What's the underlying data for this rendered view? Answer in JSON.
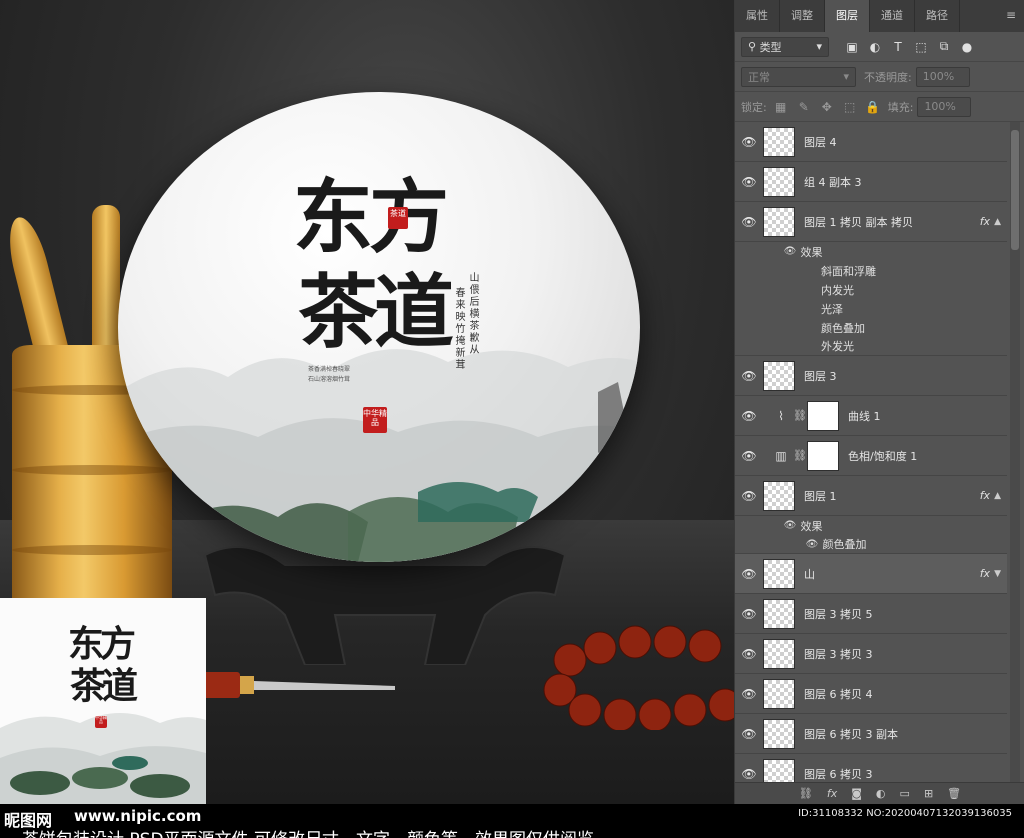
{
  "artwork": {
    "title_line1": "东方",
    "title_line2": "茶道",
    "seal_top": "茶道",
    "seal_bottom": "中华精品",
    "poem_columns": [
      "山偎后横茶歉从",
      "春来映竹掩新茸"
    ],
    "caption_lines": [
      "茶香满棹春晓翠",
      "石山溶溶烟竹茸"
    ]
  },
  "panel": {
    "tabs": [
      "属性",
      "调整",
      "图层",
      "通道",
      "路径"
    ],
    "active_tab": "图层",
    "filter_label": "类型",
    "blend_mode": "正常",
    "opacity_label": "不透明度:",
    "opacity_value": "100%",
    "lock_label": "锁定:",
    "fill_label": "填充:",
    "fill_value": "100%",
    "layers": [
      {
        "name": "图层 4",
        "kind": "image"
      },
      {
        "name": "组 4 副本 3",
        "kind": "image"
      },
      {
        "name": "图层 1 拷贝 副本 拷贝",
        "kind": "image",
        "fx": "fx"
      },
      {
        "name": "图层 3",
        "kind": "image"
      },
      {
        "name": "曲线 1",
        "kind": "adjustment"
      },
      {
        "name": "色相/饱和度 1",
        "kind": "adjustment"
      },
      {
        "name": "图层 1",
        "kind": "image",
        "fx": "fx"
      },
      {
        "name": "山",
        "kind": "image",
        "fx": "fx"
      },
      {
        "name": "图层 3 拷贝 5",
        "kind": "image"
      },
      {
        "name": "图层 3 拷贝 3",
        "kind": "image"
      },
      {
        "name": "图层 6 拷贝 4",
        "kind": "image"
      },
      {
        "name": "图层 6 拷贝 3 副本",
        "kind": "image"
      },
      {
        "name": "图层 6 拷贝 3",
        "kind": "image"
      }
    ],
    "effects_label": "效果",
    "effects_a": [
      "斜面和浮雕",
      "内发光",
      "光泽",
      "颜色叠加",
      "外发光"
    ],
    "effects_b": [
      "颜色叠加"
    ]
  },
  "footer": {
    "site_name": "昵图网",
    "site_url": "www.nipic.com",
    "image_id": "ID:31108332 NO:20200407132039136035",
    "caption": "茶饼包装设计 PSD平面源文件 可修改尺寸、文字、颜色等，效果图仅供阅览"
  }
}
